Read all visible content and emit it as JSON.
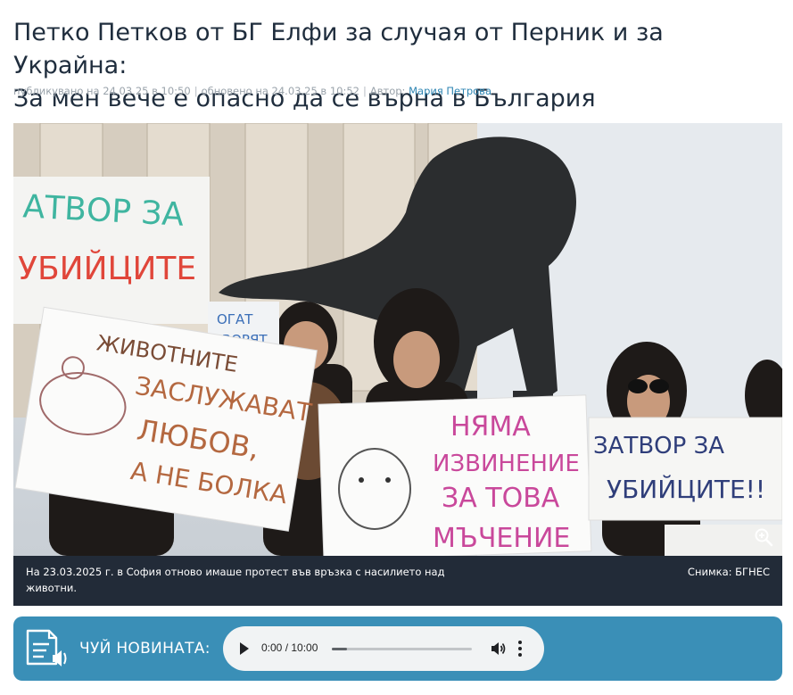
{
  "article": {
    "title_line1": "Петко Петков от БГ Елфи за случая от Перник и за Украйна:",
    "title_line2": "За мен вече е опасно да се върна в България",
    "meta": {
      "published": "публикувано на 24.03.25 в 10:50",
      "updated": "обновено на 24.03.25 в 10:52",
      "author_label": "Автор:",
      "author_name": "Мария Петрова"
    }
  },
  "photo": {
    "signs": {
      "sign_left_top_1": "АТВОР ЗА",
      "sign_left_top_2": "УБИЙЦИТЕ",
      "sign_mid_small_1": "ОГАТ",
      "sign_mid_small_2": "ОВОРЯТ",
      "sign_left_1": "ЖИВОТНИТЕ",
      "sign_left_2": "ЗАСЛУЖАВАТ",
      "sign_left_3": "ЛЮБОВ,",
      "sign_left_4": "А НЕ БОЛКА",
      "sign_center_1": "НЯМА",
      "sign_center_2": "ИЗВИНЕНИЕ",
      "sign_center_3": "ЗА ТОВА",
      "sign_center_4": "МЪЧЕНИЕ",
      "sign_right_1": "ЗАТВОР ЗА",
      "sign_right_2": "УБИЙЦИТЕ!!"
    },
    "zoom_icon": "zoom-in-icon"
  },
  "caption": {
    "text": "На 23.03.2025 г. в София отново имаше протест във връзка с насилието над животни.",
    "credit": "Снимка: БГНЕС"
  },
  "listen": {
    "label": "ЧУЙ НОВИНАТА:",
    "icon": "document-audio-icon",
    "player": {
      "time": "0:00 / 10:00",
      "progress_fraction": 0.11
    }
  },
  "colors": {
    "accent_link": "#2f86b3",
    "listen_bar": "#3a8fb7",
    "caption_bg": "#222b38",
    "headline": "#1f2d3d"
  }
}
